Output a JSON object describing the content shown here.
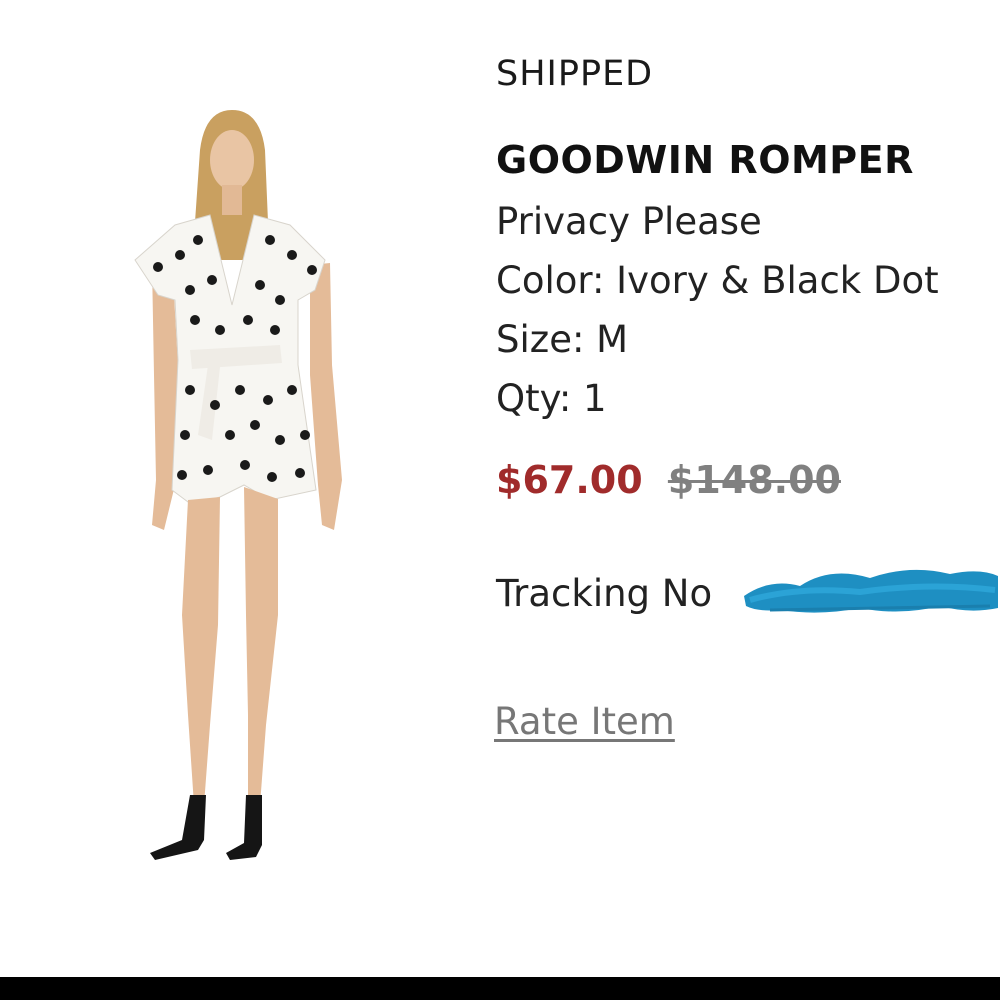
{
  "order_item": {
    "status": "SHIPPED",
    "product_name": "GOODWIN ROMPER",
    "brand": "Privacy Please",
    "color_line": "Color: Ivory & Black Dot",
    "size_line": "Size: M",
    "qty_line": "Qty: 1",
    "sale_price": "$67.00",
    "original_price": "$148.00",
    "tracking_label": "Tracking No",
    "rate_link": "Rate Item"
  },
  "colors": {
    "sale_price": "#a02b2b",
    "original_price": "#808080",
    "redaction": "#1e8fc2",
    "link": "#777777"
  },
  "icons": {
    "product_image": "product-photo-polka-dot-romper",
    "tracking_redaction": "redaction-scribble"
  }
}
